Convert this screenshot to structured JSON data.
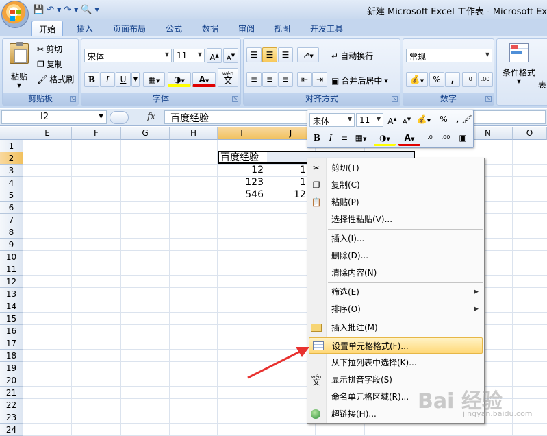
{
  "title": "新建 Microsoft Excel 工作表 - Microsoft Ex",
  "tabs": [
    "开始",
    "插入",
    "页面布局",
    "公式",
    "数据",
    "审阅",
    "视图",
    "开发工具"
  ],
  "clipboard": {
    "title": "剪贴板",
    "paste": "粘贴",
    "cut": "剪切",
    "copy": "复制",
    "format_painter": "格式刷"
  },
  "font": {
    "title": "字体",
    "name": "宋体",
    "size": "11",
    "bold": "B",
    "italic": "I",
    "underline": "U",
    "color_letter": "A",
    "wen": "wén",
    "wen_char": "文"
  },
  "alignment": {
    "title": "对齐方式",
    "wrap": "自动换行",
    "merge": "合并后居中"
  },
  "number": {
    "title": "数字",
    "format": "常规",
    "percent": "%",
    "comma": ","
  },
  "styles": {
    "cond_format": "条件格式",
    "table": "表"
  },
  "formula_bar": {
    "name": "I2",
    "fx": "fx",
    "content": "百度经验"
  },
  "columns": [
    "E",
    "F",
    "G",
    "H",
    "I",
    "J",
    "K",
    "L",
    "M",
    "N",
    "O"
  ],
  "rows": [
    "1",
    "2",
    "3",
    "4",
    "5",
    "6",
    "7",
    "8",
    "9",
    "10",
    "11",
    "12",
    "13",
    "14",
    "15",
    "16",
    "17",
    "18",
    "19",
    "20",
    "21",
    "22",
    "23",
    "24"
  ],
  "cells": {
    "i2": "百度经验",
    "i3": "12",
    "i4": "123",
    "i5": "546",
    "j3": "1",
    "j4": "1",
    "j5": "12"
  },
  "mini_toolbar": {
    "font": "宋体",
    "size": "11",
    "percent": "%",
    "comma": ","
  },
  "context_menu": [
    {
      "label": "剪切(T)",
      "icon": "scissors-icon"
    },
    {
      "label": "复制(C)",
      "icon": "copy-icon"
    },
    {
      "label": "粘贴(P)",
      "icon": "paste-icon"
    },
    {
      "label": "选择性粘贴(V)..."
    },
    {
      "label": "插入(I)..."
    },
    {
      "label": "删除(D)..."
    },
    {
      "label": "清除内容(N)"
    },
    {
      "label": "筛选(E)",
      "submenu": true
    },
    {
      "label": "排序(O)",
      "submenu": true
    },
    {
      "label": "插入批注(M)",
      "icon": "comment-icon"
    },
    {
      "label": "设置单元格格式(F)...",
      "icon": "format-cells-icon",
      "highlighted": true
    },
    {
      "label": "从下拉列表中选择(K)..."
    },
    {
      "label": "显示拼音字段(S)",
      "icon": "pinyin-icon"
    },
    {
      "label": "命名单元格区域(R)..."
    },
    {
      "label": "超链接(H)...",
      "icon": "hyperlink-icon"
    }
  ],
  "watermark": {
    "brand": "Bai 经验",
    "url": "jingyan.baidu.com"
  },
  "colors": {
    "accent": "#15428b",
    "highlight": "#ffd877",
    "arrow": "#e8312f"
  }
}
